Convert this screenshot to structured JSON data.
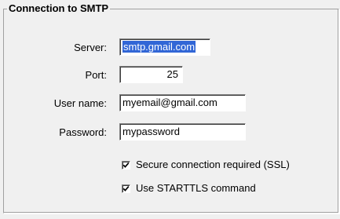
{
  "group": {
    "title": "Connection to SMTP"
  },
  "fields": {
    "server": {
      "label": "Server:",
      "value": "smtp.gmail.com"
    },
    "port": {
      "label": "Port:",
      "value": "25"
    },
    "username": {
      "label": "User name:",
      "value": "myemail@gmail.com"
    },
    "password": {
      "label": "Password:",
      "value": "mypassword"
    }
  },
  "options": {
    "ssl": {
      "label": "Secure connection required (SSL)",
      "checked": true,
      "icon": "checkmark-icon"
    },
    "starttls": {
      "label": "Use STARTTLS command",
      "checked": true,
      "icon": "checkmark-icon"
    }
  },
  "colors": {
    "background": "#f0f0f0",
    "selection": "#3166d6"
  }
}
